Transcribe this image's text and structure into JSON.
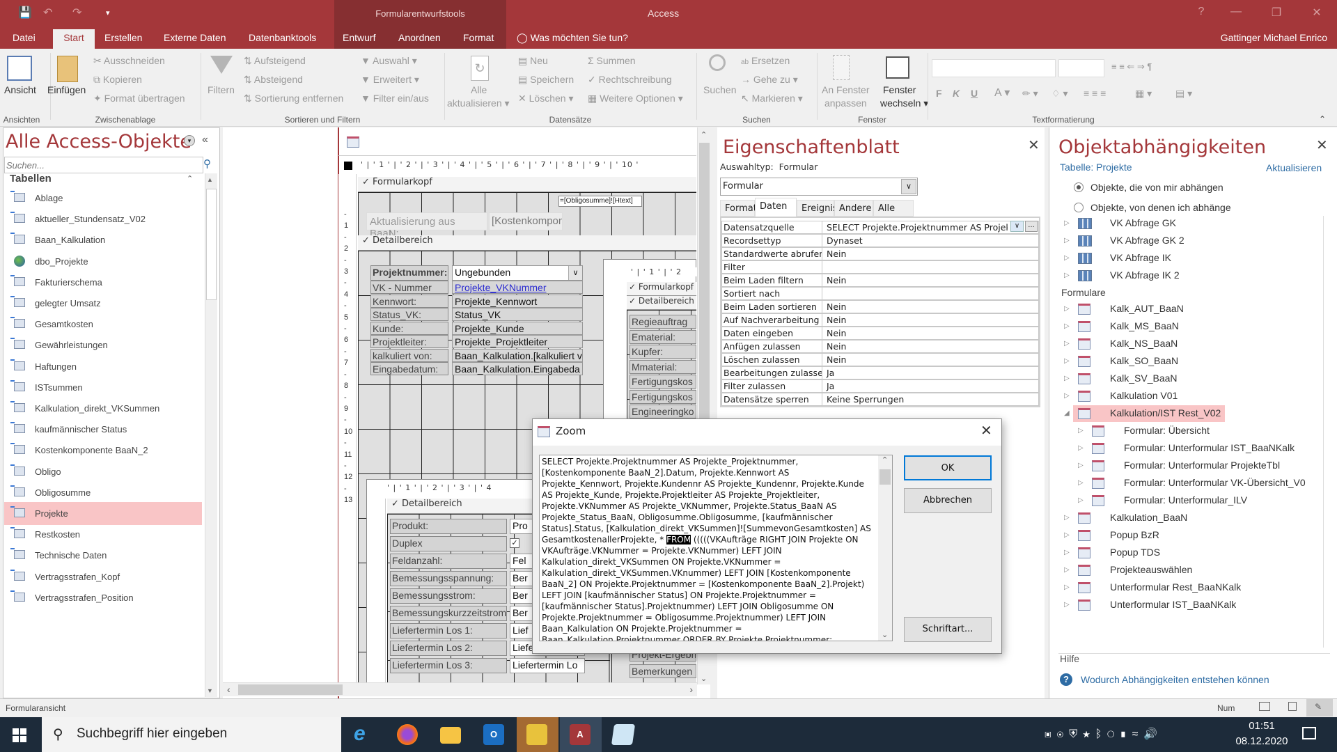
{
  "window": {
    "app_title": "Access",
    "context_tab_group": "Formularentwurfstools",
    "user": "Gattinger Michael Enrico",
    "help": "?"
  },
  "tabs": [
    "Datei",
    "Start",
    "Erstellen",
    "Externe Daten",
    "Datenbanktools",
    "Entwurf",
    "Anordnen",
    "Format"
  ],
  "tell_me": "Was möchten Sie tun?",
  "ribbon": {
    "ansicht": "Ansicht",
    "einfuegen": "Einfügen",
    "ausschneiden": "Ausschneiden",
    "kopieren": "Kopieren",
    "format_uebertragen": "Format übertragen",
    "filtern": "Filtern",
    "aufsteigend": "Aufsteigend",
    "absteigend": "Absteigend",
    "sortierung_entfernen": "Sortierung entfernen",
    "auswahl": "Auswahl",
    "erweitert": "Erweitert",
    "filter_ein_aus": "Filter ein/aus",
    "alle_aktualisieren_1": "Alle",
    "alle_aktualisieren_2": "aktualisieren",
    "neu": "Neu",
    "speichern": "Speichern",
    "loeschen": "Löschen",
    "summen": "Summen",
    "rechtschreibung": "Rechtschreibung",
    "weitere_optionen": "Weitere Optionen",
    "suchen": "Suchen",
    "ersetzen": "Ersetzen",
    "gehe_zu": "Gehe zu",
    "markieren": "Markieren",
    "an_fenster_1": "An Fenster",
    "an_fenster_2": "anpassen",
    "fenster_wechseln_1": "Fenster",
    "fenster_wechseln_2": "wechseln",
    "bold": "F",
    "italic": "K",
    "underline": "U",
    "groups": [
      "Ansichten",
      "Zwischenablage",
      "Sortieren und Filtern",
      "Datensätze",
      "Suchen",
      "Fenster",
      "Textformatierung"
    ]
  },
  "nav": {
    "title": "Alle Access-Objekte",
    "search_placeholder": "Suchen...",
    "section": "Tabellen",
    "items": [
      {
        "label": "Ablage",
        "icon": "linked-table"
      },
      {
        "label": "aktueller_Stundensatz_V02",
        "icon": "linked-table"
      },
      {
        "label": "Baan_Kalkulation",
        "icon": "linked-table"
      },
      {
        "label": "dbo_Projekte",
        "icon": "linked-odbc-table"
      },
      {
        "label": "Fakturierschema",
        "icon": "linked-table"
      },
      {
        "label": "gelegter Umsatz",
        "icon": "linked-table"
      },
      {
        "label": "Gesamtkosten",
        "icon": "linked-table"
      },
      {
        "label": "Gewährleistungen",
        "icon": "linked-table"
      },
      {
        "label": "Haftungen",
        "icon": "linked-table"
      },
      {
        "label": "ISTsummen",
        "icon": "linked-table"
      },
      {
        "label": "Kalkulation_direkt_VKSummen",
        "icon": "linked-table"
      },
      {
        "label": "kaufmännischer Status",
        "icon": "linked-table"
      },
      {
        "label": "Kostenkomponente BaaN_2",
        "icon": "linked-table"
      },
      {
        "label": "Obligo",
        "icon": "linked-table"
      },
      {
        "label": "Obligosumme",
        "icon": "linked-table"
      },
      {
        "label": "Projekte",
        "icon": "linked-table",
        "selected": true
      },
      {
        "label": "Restkosten",
        "icon": "linked-table"
      },
      {
        "label": "Technische Daten",
        "icon": "linked-table"
      },
      {
        "label": "Vertragsstrafen_Kopf",
        "icon": "linked-table"
      },
      {
        "label": "Vertragsstrafen_Position",
        "icon": "linked-table"
      }
    ]
  },
  "form_design": {
    "ruler_top": "' | ' 1 ' | ' 2 ' | ' 3 ' | ' 4 ' | ' 5 ' | ' 6 ' | ' 7 ' | ' 8 ' | ' 9 ' | ' 10 '",
    "header_section": "Formularkopf",
    "detail_section": "Detailbereich",
    "header_expr": "=[Obligosumme]![Htext]",
    "aktualisierung_label": "Aktualisierung aus BaaN:",
    "kostenkomp_field": "[Kostenkompon",
    "combo_label": "Projektnummer:",
    "combo_value": "Ungebunden",
    "rows": [
      {
        "label": "VK - Nummer",
        "value": "Projekte_VKNummer",
        "link": true
      },
      {
        "label": "Kennwort:",
        "value": "Projekte_Kennwort"
      },
      {
        "label": "Status_VK:",
        "value": "Status_VK"
      },
      {
        "label": "Kunde:",
        "value": "Projekte_Kunde"
      },
      {
        "label": "Projektleiter:",
        "value": "Projekte_Projektleiter"
      },
      {
        "label": "kalkuliert von:",
        "value": "Baan_Kalkulation.[kalkuliert v"
      },
      {
        "label": "Eingabedatum:",
        "value": "Baan_Kalkulation.Eingabeda"
      }
    ],
    "sub1": {
      "ruler": "' | ' 1 ' | ' 2",
      "header_section": "Formularkopf",
      "detail_section": "Detailbereich",
      "labels": [
        "Regieauftrag",
        "Ematerial:",
        "Kupfer:",
        "Mmaterial:",
        "Fertigungskos",
        "Fertigungskos",
        "Engineeringko"
      ],
      "bottom_labels": [
        "Projekt-Ergebn",
        "Bemerkungen"
      ]
    },
    "sub2": {
      "ruler": "' | ' 1 ' | ' 2 ' | ' 3 ' | ' 4",
      "detail_section": "Detailbereich",
      "rows": [
        {
          "label": "Produkt:",
          "value": "Pro"
        },
        {
          "label": "Duplex",
          "value": "",
          "checkbox": true
        },
        {
          "label": "Feldanzahl:",
          "value": "Fel"
        },
        {
          "label": "Bemessungsspannung:",
          "value": "Ber"
        },
        {
          "label": "Bemessungsstrom:",
          "value": "Ber"
        },
        {
          "label": "Bemessungskurzzeitstrom",
          "value": "Ber"
        },
        {
          "label": "Liefertermin Los 1:",
          "value": "Lief"
        },
        {
          "label": "Liefertermin Los 2:",
          "value": "Liefertermin Lo"
        },
        {
          "label": "Liefertermin Los 3:",
          "value": "Liefertermin Lo"
        }
      ]
    },
    "vruler": [
      "-",
      "1",
      "-",
      "2",
      "-",
      "3",
      "-",
      "4",
      "-",
      "5",
      "-",
      "6",
      "-",
      "7",
      "-",
      "8",
      "-",
      "9",
      "-",
      "10",
      "-",
      "11",
      "-",
      "12",
      "-",
      "13"
    ]
  },
  "properties": {
    "title": "Eigenschaftenblatt",
    "selection_type_label": "Auswahltyp:",
    "selection_type_value": "Formular",
    "object_select": "Formular",
    "tabs": [
      "Format",
      "Daten",
      "Ereignis",
      "Andere",
      "Alle"
    ],
    "active_tab": "Daten",
    "rows": [
      {
        "key": "Datensatzquelle",
        "value": "SELECT Projekte.Projektnummer AS Projekte_P"
      },
      {
        "key": "Recordsettyp",
        "value": "Dynaset"
      },
      {
        "key": "Standardwerte abrufen",
        "value": "Nein"
      },
      {
        "key": "Filter",
        "value": ""
      },
      {
        "key": "Beim Laden filtern",
        "value": "Nein"
      },
      {
        "key": "Sortiert nach",
        "value": ""
      },
      {
        "key": "Beim Laden sortieren",
        "value": "Nein"
      },
      {
        "key": "Auf Nachverarbeitung wa",
        "value": "Nein"
      },
      {
        "key": "Daten eingeben",
        "value": "Nein"
      },
      {
        "key": "Anfügen zulassen",
        "value": "Nein"
      },
      {
        "key": "Löschen zulassen",
        "value": "Nein"
      },
      {
        "key": "Bearbeitungen zulassen",
        "value": "Ja"
      },
      {
        "key": "Filter zulassen",
        "value": "Ja"
      },
      {
        "key": "Datensätze sperren",
        "value": "Keine Sperrungen"
      }
    ]
  },
  "zoom_dialog": {
    "title": "Zoom",
    "sql_before": "SELECT Projekte.Projektnummer AS Projekte_Projektnummer, [Kostenkomponente BaaN_2].Datum, Projekte.Kennwort AS Projekte_Kennwort, Projekte.Kundennr AS Projekte_Kundennr, Projekte.Kunde AS Projekte_Kunde, Projekte.Projektleiter AS Projekte_Projektleiter, Projekte.VKNummer AS Projekte_VKNummer, Projekte.Status_BaaN AS Projekte_Status_BaaN, Obligosumme.Obligosumme, [kaufmännischer Status].Status, [Kalkulation_direkt_VKSummen]![SummevonGesamtkosten] AS GesamtkostenallerProjekte, * ",
    "sql_highlight": "FROM",
    "sql_after": " (((((VKAufträge RIGHT JOIN Projekte ON VKAufträge.VKNummer = Projekte.VKNummer) LEFT JOIN Kalkulation_direkt_VKSummen ON Projekte.VKNummer = Kalkulation_direkt_VKSummen.VKnummer) LEFT JOIN [Kostenkomponente BaaN_2] ON Projekte.Projektnummer = [Kostenkomponente BaaN_2].Projekt) LEFT JOIN [kaufmännischer Status] ON Projekte.Projektnummer = [kaufmännischer Status].Projektnummer) LEFT JOIN Obligosumme ON Projekte.Projektnummer = Obligosumme.Projektnummer) LEFT JOIN Baan_Kalkulation ON Projekte.Projektnummer = Baan_Kalkulation.Projektnummer ORDER BY Projekte.Projektnummer;",
    "ok": "OK",
    "cancel": "Abbrechen",
    "font": "Schriftart..."
  },
  "dependencies": {
    "title": "Objektabhängigkeiten",
    "subtitle": "Tabelle: Projekte",
    "refresh": "Aktualisieren",
    "radio_1": "Objekte, die von mir abhängen",
    "radio_2": "Objekte, von denen ich abhänge",
    "radio_selected": 1,
    "queries": [
      "VK Abfrage GK",
      "VK Abfrage GK 2",
      "VK Abfrage IK",
      "VK Abfrage IK 2"
    ],
    "forms_header": "Formulare",
    "forms": [
      {
        "label": "Kalk_AUT_BaaN",
        "level": 0
      },
      {
        "label": "Kalk_MS_BaaN",
        "level": 0
      },
      {
        "label": "Kalk_NS_BaaN",
        "level": 0
      },
      {
        "label": "Kalk_SO_BaaN",
        "level": 0
      },
      {
        "label": "Kalk_SV_BaaN",
        "level": 0
      },
      {
        "label": "Kalkulation V01",
        "level": 0
      },
      {
        "label": "Kalkulation/IST Rest_V02",
        "level": 0,
        "expanded": true,
        "selected": true
      },
      {
        "label": "Formular: Übersicht",
        "level": 1
      },
      {
        "label": "Formular: Unterformular IST_BaaNKalk",
        "level": 1
      },
      {
        "label": "Formular: Unterformular ProjekteTbl",
        "level": 1
      },
      {
        "label": "Formular: Unterformular VK-Übersicht_V0",
        "level": 1
      },
      {
        "label": "Formular: Unterformular_ILV",
        "level": 1
      },
      {
        "label": "Kalkulation_BaaN",
        "level": 0
      },
      {
        "label": "Popup BzR",
        "level": 0
      },
      {
        "label": "Popup TDS",
        "level": 0
      },
      {
        "label": "Projekteauswählen",
        "level": 0
      },
      {
        "label": "Unterformular  Rest_BaaNKalk",
        "level": 0
      },
      {
        "label": "Unterformular IST_BaaNKalk",
        "level": 0
      }
    ],
    "help_header": "Hilfe",
    "help_link": "Wodurch Abhängigkeiten entstehen können"
  },
  "status": {
    "left": "Formularansicht",
    "num": "Num"
  },
  "taskbar": {
    "search_placeholder": "Suchbegriff hier eingeben",
    "time": "01:51",
    "date": "08.12.2020"
  },
  "colors": {
    "accent": "#a4373a",
    "context_band": "#862f31",
    "selection": "#f9c5c6",
    "link": "#2e6ca4"
  }
}
